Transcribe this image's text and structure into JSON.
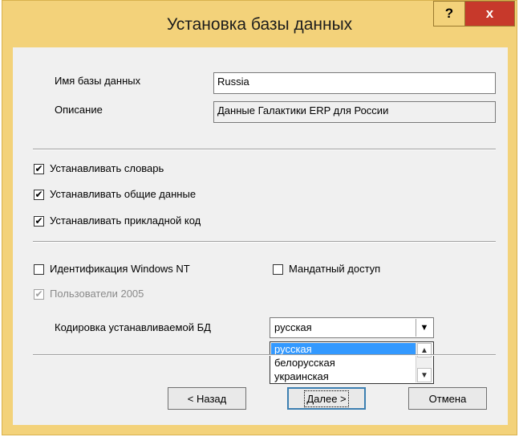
{
  "window": {
    "title": "Установка базы данных",
    "help_label": "?",
    "close_label": "x"
  },
  "form": {
    "db_name_label": "Имя базы данных",
    "db_name_value": "Russia",
    "description_label": "Описание",
    "description_value": "Данные Галактики ERP для России"
  },
  "options": {
    "install_dictionary": {
      "label": "Устанавливать словарь",
      "checked": true
    },
    "install_common_data": {
      "label": "Устанавливать общие данные",
      "checked": true
    },
    "install_app_code": {
      "label": "Устанавливать прикладной код",
      "checked": true
    },
    "windows_nt_auth": {
      "label": "Идентификация Windows NT",
      "checked": false
    },
    "mandatory_access": {
      "label": "Мандатный доступ",
      "checked": false
    },
    "users_2005": {
      "label": "Пользователи 2005",
      "checked": true,
      "disabled": true
    }
  },
  "encoding": {
    "label": "Кодировка устанавливаемой БД",
    "selected": "русская",
    "options": [
      "русская",
      "белорусская",
      "украинская"
    ]
  },
  "buttons": {
    "back": "< Назад",
    "next": "Далее >",
    "cancel": "Отмена"
  },
  "check_mark": "✔",
  "icons": {
    "up": "up-arrow-icon",
    "down": "down-arrow-icon"
  }
}
